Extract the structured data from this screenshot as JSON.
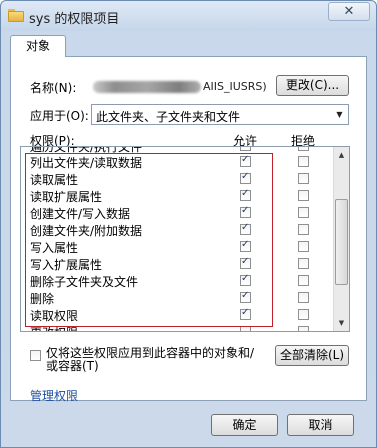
{
  "window": {
    "title": "sys 的权限项目",
    "close_glyph": "✕"
  },
  "tabs": [
    {
      "label": "对象"
    }
  ],
  "name": {
    "label": "名称(N):",
    "value_visible": "AIIS_IUSRS)",
    "change_button": "更改(C)..."
  },
  "apply_to": {
    "label": "应用于(O):",
    "selected": "此文件夹、子文件夹和文件"
  },
  "permissions": {
    "label": "权限(P):",
    "allow_header": "允许",
    "deny_header": "拒绝",
    "rows": [
      {
        "label": "遍历文件夹/执行文件",
        "allow": true,
        "deny": false
      },
      {
        "label": "列出文件夹/读取数据",
        "allow": true,
        "deny": false
      },
      {
        "label": "读取属性",
        "allow": true,
        "deny": false
      },
      {
        "label": "读取扩展属性",
        "allow": true,
        "deny": false
      },
      {
        "label": "创建文件/写入数据",
        "allow": true,
        "deny": false
      },
      {
        "label": "创建文件夹/附加数据",
        "allow": true,
        "deny": false
      },
      {
        "label": "写入属性",
        "allow": true,
        "deny": false
      },
      {
        "label": "写入扩展属性",
        "allow": true,
        "deny": false
      },
      {
        "label": "删除子文件夹及文件",
        "allow": true,
        "deny": false
      },
      {
        "label": "删除",
        "allow": true,
        "deny": false
      },
      {
        "label": "读取权限",
        "allow": true,
        "deny": false
      },
      {
        "label": "更改权限",
        "allow": false,
        "deny": false
      }
    ]
  },
  "apply_container_only": {
    "checked": false,
    "text": "仅将这些权限应用到此容器中的对象和/或容器(T)"
  },
  "clear_all_button": "全部清除(L)",
  "manage_link": "管理权限",
  "footer": {
    "ok": "确定",
    "cancel": "取消"
  }
}
